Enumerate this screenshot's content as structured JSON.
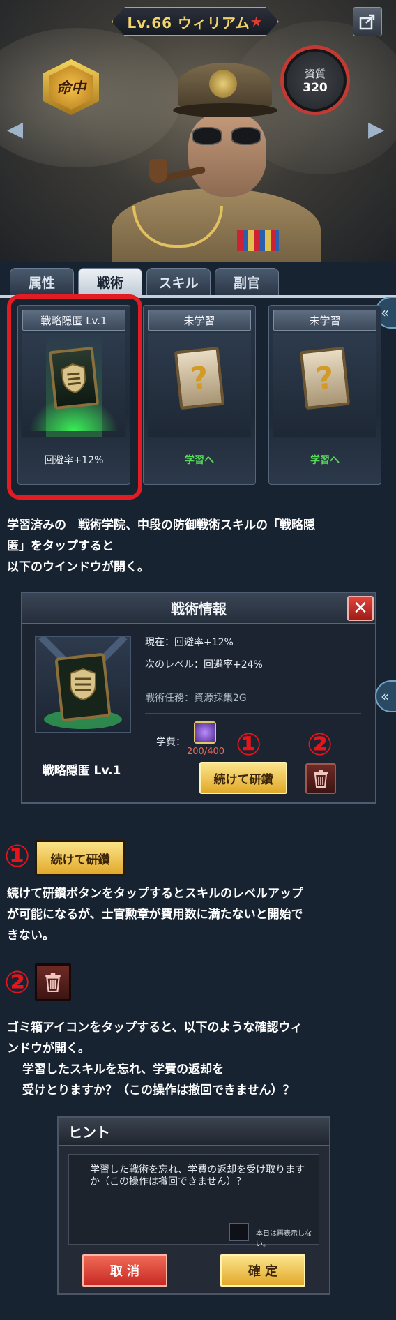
{
  "hero": {
    "title": "Lv.66 ウィリアム",
    "title_star": "★",
    "hit_badge": "命中",
    "aptitude_label": "資質",
    "aptitude_value": "320",
    "arrow_left": "◀",
    "arrow_right": "▶"
  },
  "tabs": [
    {
      "label": "属性",
      "active": false
    },
    {
      "label": "戦術",
      "active": true
    },
    {
      "label": "スキル",
      "active": false
    },
    {
      "label": "副官",
      "active": false
    }
  ],
  "side_toggle": "«",
  "cards": [
    {
      "header": "戦略隠匿 Lv.1",
      "footer": "回避率+12%"
    },
    {
      "header": "未学習",
      "footer": "学習へ"
    },
    {
      "header": "未学習",
      "footer": "学習へ"
    }
  ],
  "explain1": {
    "line1": "学習済みの　戦術学院、中段の防御戦術スキルの「戦略隠",
    "line2": "匿」をタップすると",
    "line3": "以下のウインドウが開く。"
  },
  "tactic_dialog": {
    "title": "戦術情報",
    "close": "✕",
    "name": "戦略隠匿 Lv.1",
    "current": "現在：回避率+12%",
    "next": "次のレベル：回避率+24%",
    "mission": "戦術任務：資源採集2G",
    "fee_label": "学費：",
    "fee_value": "200/400",
    "continue_button": "続けて研鑽",
    "marker1": "①",
    "marker2": "②"
  },
  "explain2": {
    "marker": "①",
    "button": "続けて研鑽",
    "line1": "続けて研鑽ボタンをタップするとスキルのレベルアップ",
    "line2": "が可能になるが、士官勲章が費用数に満たないと開始で",
    "line3": "きない。"
  },
  "explain3": {
    "marker": "②",
    "line1": "ゴミ箱アイコンをタップすると、以下のような確認ウィ",
    "line2": "ンドウが開く。",
    "line3": "学習したスキルを忘れ、学費の返却を",
    "line4": "受けとりますか？（この操作は撤回できません）？"
  },
  "hint_dialog": {
    "title": "ヒント",
    "message": "学習した戦術を忘れ、学費の返却を受け取りますか（この操作は撤回できません）？",
    "checkbox_label": "本日は再表示しない。",
    "cancel": "取 消",
    "confirm": "確 定"
  }
}
